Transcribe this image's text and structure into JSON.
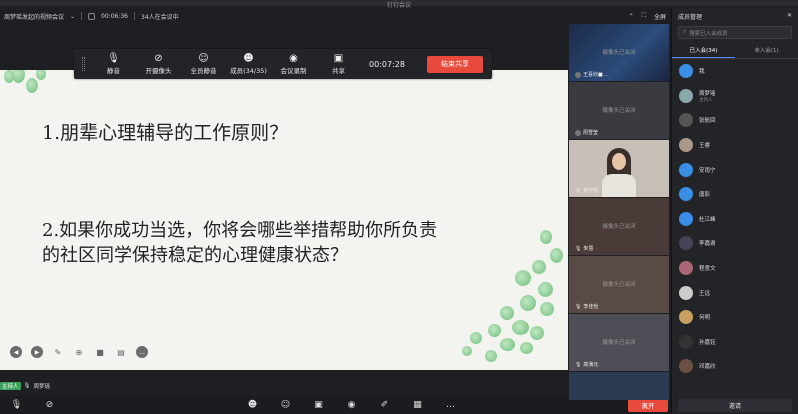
{
  "window": {
    "title": "钉钉会议"
  },
  "infobar": {
    "meeting_name": "周梦瑶发起的视频会议",
    "timer": "00:06:36",
    "attendees": "34人在会议中"
  },
  "toolbar": {
    "mute": "静音",
    "camera": "开摄像头",
    "mute_all": "全员静音",
    "members": "成员(34/35)",
    "record": "会议录制",
    "share": "共享",
    "elapsed": "00:07:28",
    "end_share": "结束共享"
  },
  "slide": {
    "q1": "1.朋辈心理辅导的工作原则？",
    "q2_line1": "2.如果你成功当选，你将会哪些举措帮助你所负责",
    "q2_line2": "的社区同学保持稳定的心理健康状态？"
  },
  "host": {
    "tag": "主持人",
    "name": "周梦瑶"
  },
  "video_strip": {
    "fullscreen": "全屏",
    "tiles": [
      {
        "name": "王喜欣■…",
        "status": "摄像头已关闭"
      },
      {
        "name": "周雪莹",
        "status": "摄像头已关闭"
      },
      {
        "name": "杨宇阳",
        "status": ""
      },
      {
        "name": "朱慧",
        "status": "摄像头已关闭"
      },
      {
        "name": "李佳怡",
        "status": "摄像头已关闭"
      },
      {
        "name": "高演元",
        "status": "摄像头已关闭"
      },
      {
        "name": "",
        "status": ""
      }
    ]
  },
  "panel": {
    "title": "成员管理",
    "search_placeholder": "搜索已入会成员",
    "tab_joined": "已入会(34)",
    "tab_not_joined": "未入会(1)",
    "members": [
      {
        "name": "我",
        "sub": ""
      },
      {
        "name": "周梦瑶",
        "sub": "主持人"
      },
      {
        "name": "张航回",
        "sub": ""
      },
      {
        "name": "王睿",
        "sub": ""
      },
      {
        "name": "安雨宁",
        "sub": ""
      },
      {
        "name": "唐彭",
        "sub": ""
      },
      {
        "name": "杜江峰",
        "sub": ""
      },
      {
        "name": "李嘉谢",
        "sub": ""
      },
      {
        "name": "程意文",
        "sub": ""
      },
      {
        "name": "王远",
        "sub": ""
      },
      {
        "name": "何明",
        "sub": ""
      },
      {
        "name": "孙嘉钰",
        "sub": ""
      },
      {
        "name": "邓嘉欣",
        "sub": ""
      }
    ],
    "bottom_button": "邀请"
  },
  "bottombar": {
    "end": "离开"
  }
}
